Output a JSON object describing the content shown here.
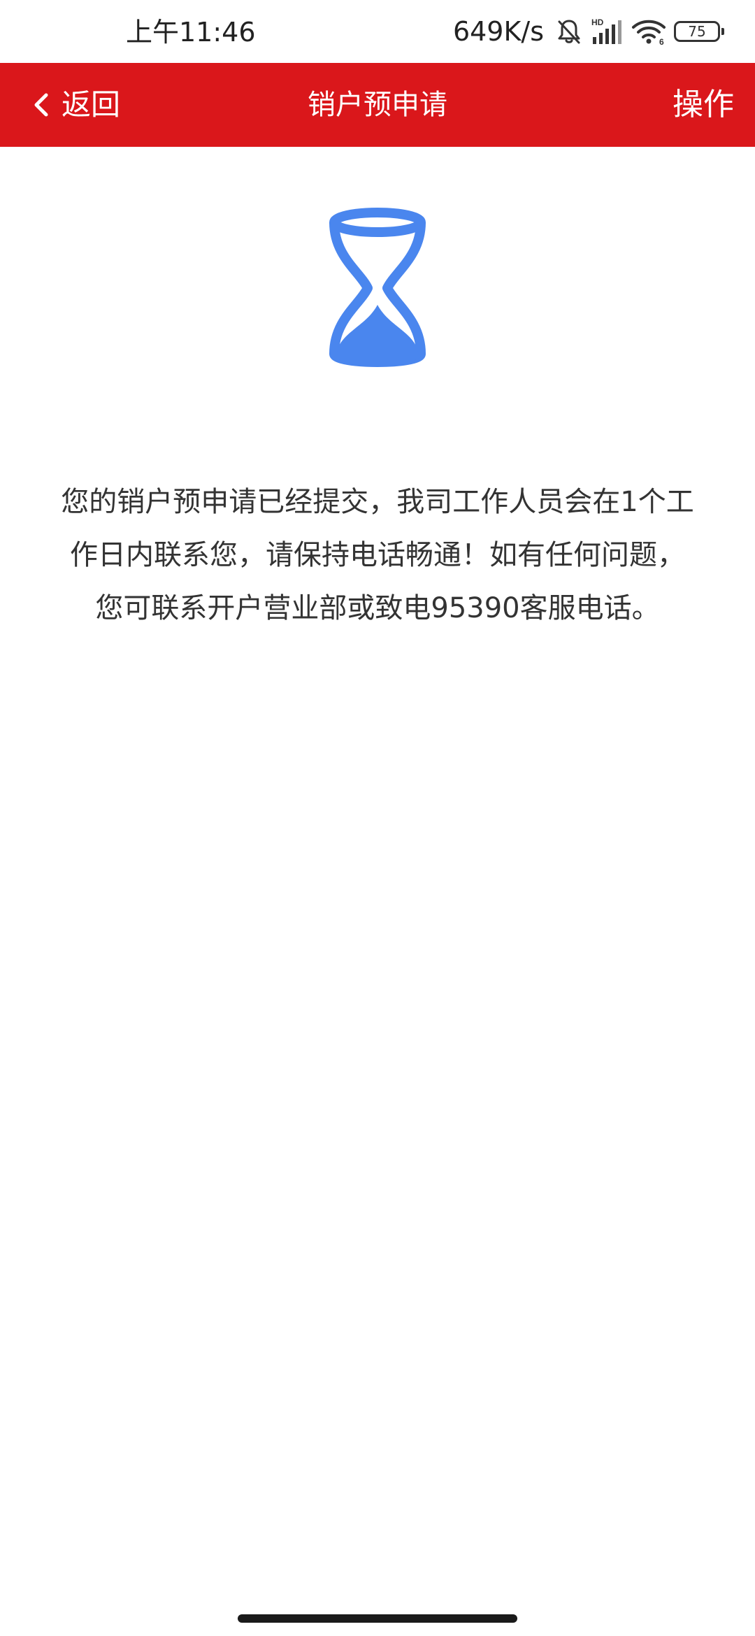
{
  "status_bar": {
    "time": "上午11:46",
    "net_speed": "649K/s",
    "network_badge": "HD",
    "wifi_badge": "6",
    "battery_level": "75",
    "icons": [
      "bell-muted-icon",
      "signal-icon",
      "wifi-icon",
      "battery-icon"
    ]
  },
  "nav": {
    "back_label": "返回",
    "title": "销户预申请",
    "action_label": "操作",
    "background_color": "#da171b"
  },
  "content": {
    "status_icon": "hourglass-icon",
    "icon_color": "#4a86ee",
    "message_lines": [
      "您的销户预申请已经提交，我司工作人员会在1个工",
      "作日内联系您，请保持电话畅通！如有任何问题，",
      "您可联系开户营业部或致电95390客服电话。"
    ]
  }
}
